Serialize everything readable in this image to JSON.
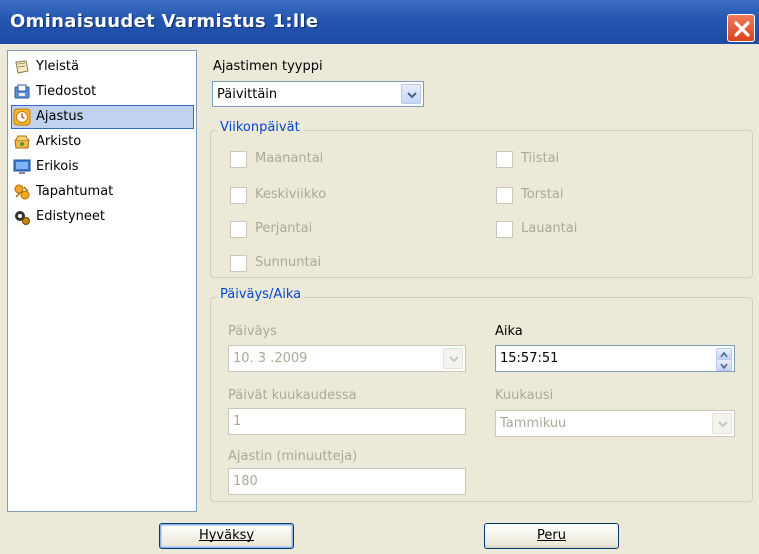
{
  "window": {
    "title": "Ominaisuudet Varmistus 1:lle"
  },
  "sidebar": {
    "items": [
      {
        "label": "Yleistä",
        "icon": "scroll-icon"
      },
      {
        "label": "Tiedostot",
        "icon": "files-icon"
      },
      {
        "label": "Ajastus",
        "icon": "clock-icon",
        "selected": true
      },
      {
        "label": "Arkisto",
        "icon": "archive-icon"
      },
      {
        "label": "Erikois",
        "icon": "monitor-icon"
      },
      {
        "label": "Tapahtumat",
        "icon": "events-icon"
      },
      {
        "label": "Edistyneet",
        "icon": "advanced-icon"
      }
    ]
  },
  "timer": {
    "type_label": "Ajastimen tyyppi",
    "type_value": "Päivittäin"
  },
  "weekdays": {
    "legend": "Viikonpäivät",
    "days": [
      "Maanantai",
      "Tiistai",
      "Keskiviikko",
      "Torstai",
      "Perjantai",
      "Lauantai",
      "Sunnuntai"
    ]
  },
  "datetime": {
    "legend": "Päiväys/Aika",
    "date_label": "Päiväys",
    "date_value": "10. 3 .2009",
    "time_label": "Aika",
    "time_value": "15:57:51",
    "days_in_month_label": "Päivät kuukaudessa",
    "days_in_month_value": "1",
    "month_label": "Kuukausi",
    "month_value": "Tammikuu",
    "timer_minutes_label": "Ajastin (minuutteja)",
    "timer_minutes_value": "180"
  },
  "buttons": {
    "ok": "Hyväksy",
    "cancel": "Peru"
  },
  "colors": {
    "titlebar": "#2456b1",
    "group_legend": "#0046d5",
    "selection": "#c1d2ee",
    "close": "#d9441e"
  }
}
